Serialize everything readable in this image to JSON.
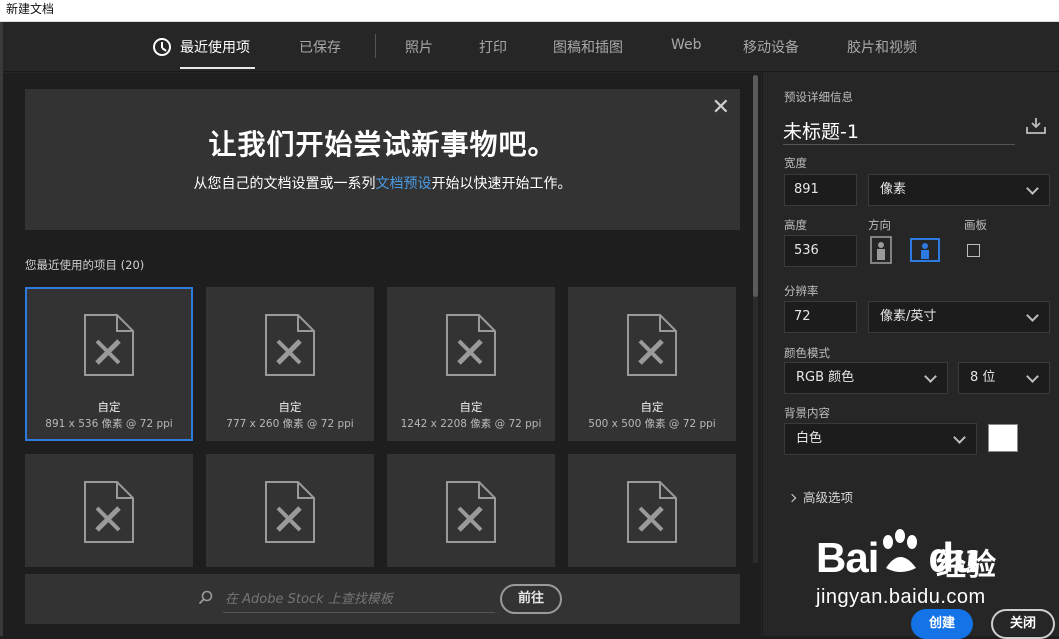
{
  "window": {
    "title": "新建文档"
  },
  "tabs": [
    {
      "label": "最近使用项",
      "active": true
    },
    {
      "label": "已保存"
    },
    {
      "label": "照片"
    },
    {
      "label": "打印"
    },
    {
      "label": "图稿和插图"
    },
    {
      "label": "Web"
    },
    {
      "label": "移动设备"
    },
    {
      "label": "胶片和视频"
    }
  ],
  "banner": {
    "title": "让我们开始尝试新事物吧。",
    "subtitle_before": "从您自己的文档设置或一系列",
    "subtitle_link": "文档预设",
    "subtitle_after": "开始以快速开始工作。"
  },
  "recent": {
    "label": "您最近使用的项目",
    "count": "(20)",
    "items": [
      {
        "name": "自定",
        "meta": "891 x 536 像素 @ 72 ppi",
        "selected": true
      },
      {
        "name": "自定",
        "meta": "777 x 260 像素 @ 72 ppi"
      },
      {
        "name": "自定",
        "meta": "1242 x 2208 像素 @ 72 ppi"
      },
      {
        "name": "自定",
        "meta": "500 x 500 像素 @ 72 ppi"
      },
      {
        "name": "",
        "meta": ""
      },
      {
        "name": "",
        "meta": ""
      },
      {
        "name": "",
        "meta": ""
      },
      {
        "name": "",
        "meta": ""
      }
    ]
  },
  "stock": {
    "placeholder": "在 Adobe Stock 上查找模板",
    "go_label": "前往"
  },
  "preset": {
    "section_label": "预设详细信息",
    "name": "未标题-1",
    "width_label": "宽度",
    "width_value": "891",
    "width_unit": "像素",
    "height_label": "高度",
    "height_value": "536",
    "orientation_label": "方向",
    "artboard_label": "画板",
    "resolution_label": "分辨率",
    "resolution_value": "72",
    "resolution_unit": "像素/英寸",
    "color_mode_label": "颜色模式",
    "color_mode": "RGB 颜色",
    "bit_depth": "8 位",
    "background_label": "背景内容",
    "background": "白色",
    "background_swatch": "#ffffff",
    "advanced_label": "高级选项"
  },
  "buttons": {
    "create": "创建",
    "close": "关闭"
  },
  "watermark": {
    "brand_a": "Bai",
    "brand_b": "du",
    "brand_cn": "经验",
    "url": "jingyan.baidu.com"
  },
  "colors": {
    "accent": "#1473e6",
    "link": "#4a9be6",
    "selected_border": "#2d7be0"
  }
}
